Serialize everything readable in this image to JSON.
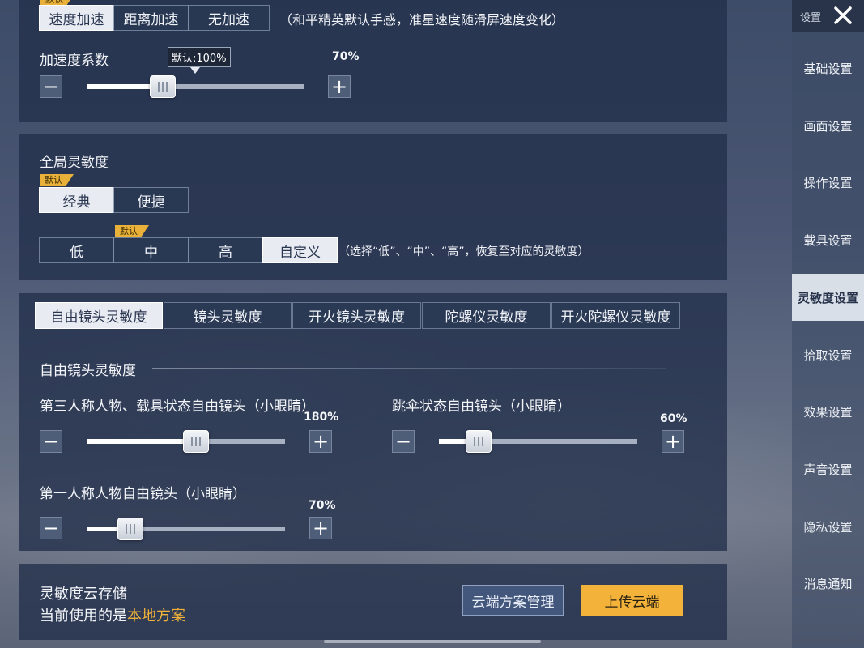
{
  "accel": {
    "options": [
      "速度加速",
      "距离加速",
      "无加速"
    ],
    "active_index": 0,
    "note": "（和平精英默认手感，准星速度随滑屏速度变化）",
    "coef_label": "加速度系数",
    "tooltip": "默认:100%",
    "value_text": "70%",
    "value": 0.35
  },
  "global": {
    "title": "全局灵敏度",
    "default_badge": "默认",
    "modes": [
      "经典",
      "便捷"
    ],
    "active_mode": 0,
    "levels": [
      "低",
      "中",
      "高",
      "自定义"
    ],
    "active_level": 3,
    "levels_note": "（选择“低”、“中”、“高”，恢复至对应的灵敏度）"
  },
  "tabs": [
    "自由镜头灵敏度",
    "镜头灵敏度",
    "开火镜头灵敏度",
    "陀螺仪灵敏度",
    "开火陀螺仪灵敏度"
  ],
  "active_tab": 0,
  "freecam": {
    "section_title": "自由镜头灵敏度",
    "sliders": [
      {
        "label": "第三人称人物、载具状态自由镜头（小眼睛）",
        "value_text": "180%",
        "value": 0.55
      },
      {
        "label": "跳伞状态自由镜头（小眼睛）",
        "value_text": "60%",
        "value": 0.2
      },
      {
        "label": "第一人称人物自由镜头（小眼睛）",
        "value_text": "70%",
        "value": 0.22
      }
    ]
  },
  "cloud": {
    "title": "灵敏度云存储",
    "current_prefix": "当前使用的是",
    "current_value": "本地方案",
    "manage_label": "云端方案管理",
    "upload_label": "上传云端"
  },
  "sidebar": {
    "header": "设置",
    "items": [
      "基础设置",
      "画面设置",
      "操作设置",
      "载具设置",
      "灵敏度设置",
      "拾取设置",
      "效果设置",
      "声音设置",
      "隐私设置",
      "消息通知"
    ],
    "active_index": 4
  },
  "colors": {
    "accent": "#e9b13a",
    "highlight_text": "#f2b23a",
    "upload_button": "#f3b23a"
  }
}
